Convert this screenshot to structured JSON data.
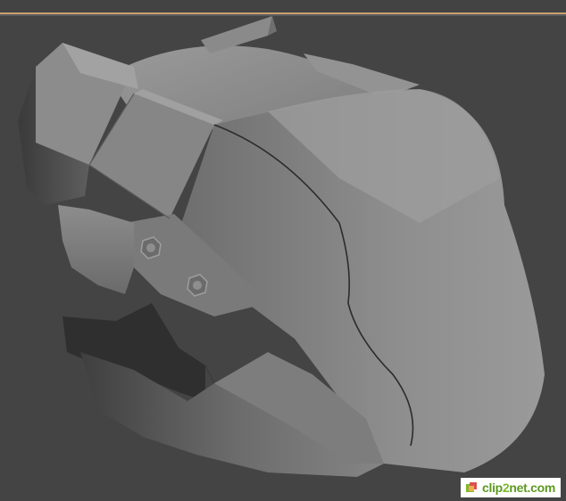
{
  "viewport": {
    "background": "#444444",
    "accent_line": "#c9a173",
    "model_color": "#8d8d8d"
  },
  "watermark": {
    "text_prefix": "clip",
    "text_digit": "2",
    "text_suffix": "net.com",
    "color": "#5c9a1f",
    "icon": "clip2net-logo-icon"
  }
}
